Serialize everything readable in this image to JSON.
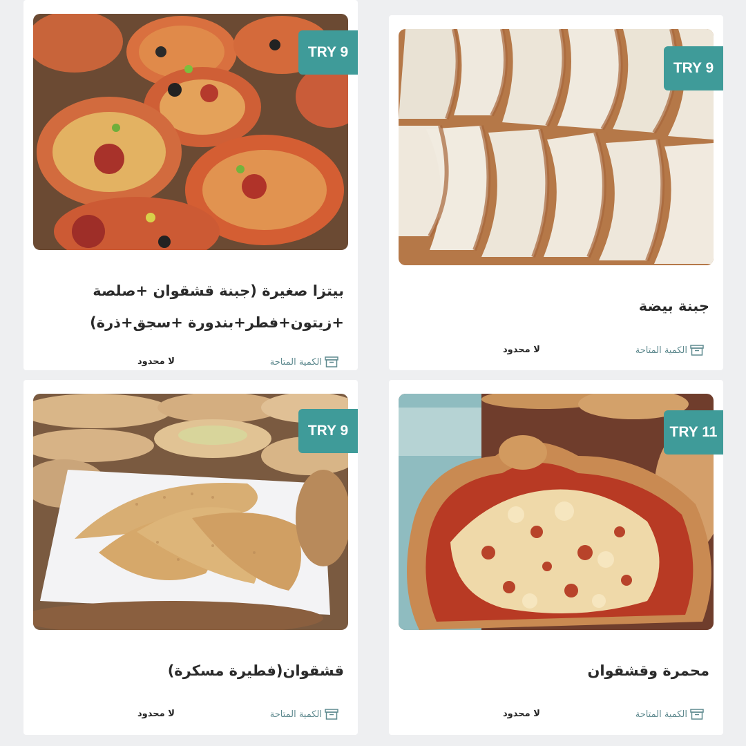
{
  "cards": [
    {
      "price": "TRY 9",
      "title_line1": "بيتزا صغيرة (جبنة قشقوان +صلصة",
      "title_line2": "+زيتون+فطر+بندورة +سجق+ذرة)",
      "availability_label": "الكمية المتاحة",
      "availability_value": "لا محدود",
      "image": "mini-pizza-photo"
    },
    {
      "price": "TRY 9",
      "title_line1": "جبنة بيضة",
      "availability_label": "الكمية المتاحة",
      "availability_value": "لا محدود",
      "image": "white-cheese-pastry-photo"
    },
    {
      "price": "TRY 9",
      "title_line1": "قشقوان(فطيرة مسكرة)",
      "availability_label": "الكمية المتاحة",
      "availability_value": "لا محدود",
      "image": "closed-kashkaval-pie-photo"
    },
    {
      "price": "TRY 11",
      "title_line1": "محمرة وقشقوان",
      "availability_label": "الكمية المتاحة",
      "availability_value": "لا محدود",
      "image": "muhammara-kashkaval-photo"
    }
  ],
  "colors": {
    "price_badge": "#3f9b99",
    "availability_label": "#5f8a8f"
  }
}
